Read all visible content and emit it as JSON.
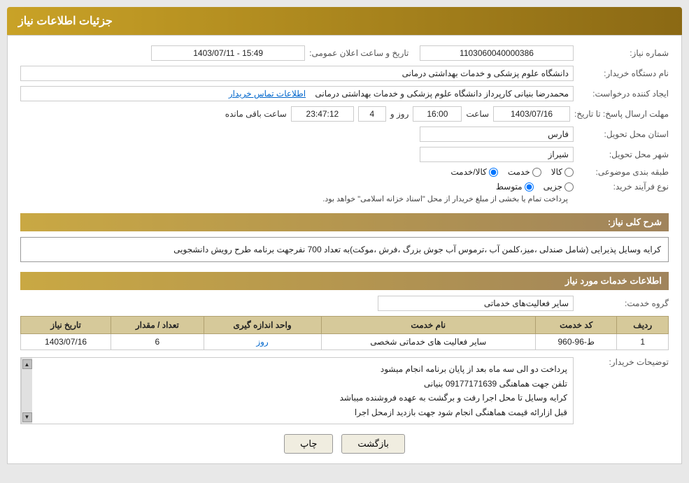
{
  "header": {
    "title": "جزئیات اطلاعات نیاز"
  },
  "fields": {
    "shomareNiaz_label": "شماره نیاز:",
    "shomareNiaz_value": "1103060040000386",
    "namDastgah_label": "نام دستگاه خریدار:",
    "namDastgah_value": "دانشگاه علوم پزشکی و خدمات بهداشتی درمانی",
    "ijadKonande_label": "ایجاد کننده درخواست:",
    "ijadKonande_value": "محمدرضا بنیانی کارپرداز دانشگاه علوم پزشکی و خدمات بهداشتی درمانی",
    "ijadKonande_link": "اطلاعات تماس خریدار",
    "mohlatErsalPasokh_label": "مهلت ارسال پاسخ: تا تاریخ:",
    "date_value": "1403/07/16",
    "saat_label": "ساعت",
    "saat_value": "16:00",
    "roz_label": "روز و",
    "roz_value": "4",
    "baghi_label": "ساعت باقی مانده",
    "baghi_value": "23:47:12",
    "ostan_label": "استان محل تحویل:",
    "ostan_value": "فارس",
    "shahr_label": "شهر محل تحویل:",
    "shahr_value": "شیراز",
    "tabaqebandi_label": "طبقه بندی موضوعی:",
    "radio_options": [
      "کالا",
      "خدمت",
      "کالا/خدمت"
    ],
    "radio_selected": "کالا/خدمت",
    "noeFarayand_label": "نوع فرآیند خرید:",
    "radio2_options": [
      "جزیی",
      "متوسط"
    ],
    "radio2_selected": "متوسط",
    "noeFarayand_notice": "پرداخت تمام یا بخشی از مبلغ خریدار از محل \"اسناد خزانه اسلامی\" خواهد بود.",
    "sharh_label": "شرح کلی نیاز:",
    "sharh_value": "کرایه وسایل پذیرایی (شامل صندلی ،میز،کلمن آب ،ترموس آب جوش بزرگ ،فرش ،موکت)به تعداد 700 نفرجهت برنامه طرح رویش دانشجویی",
    "info_section_title": "اطلاعات خدمات مورد نیاز",
    "groheKhedmat_label": "گروه خدمت:",
    "groheKhedmat_value": "سایر فعالیت‌های خدماتی",
    "table_headers": [
      "ردیف",
      "کد خدمت",
      "نام خدمت",
      "واحد اندازه گیری",
      "تعداد / مقدار",
      "تاریخ نیاز"
    ],
    "table_rows": [
      {
        "radif": "1",
        "kodKhedmat": "ط-96-960",
        "namKhedmat": "سایر فعالیت های خدماتی شخصی",
        "vahed": "روز",
        "tedad": "6",
        "tarikhNiaz": "1403/07/16"
      }
    ],
    "buyer_desc_label": "توضیحات خریدار:",
    "buyer_desc_lines": [
      "پرداخت دو الی سه ماه بعد از پایان برنامه انجام میشود",
      "تلفن جهت هماهنگی 09177171639 بنیانی",
      "کرایه وسایل تا محل اجرا رفت و برگشت به عهده فروشنده میباشد",
      "قبل ازارائه قیمت هماهنگی انجام شود جهت بازدید ازمحل اجرا"
    ]
  },
  "buttons": {
    "print_label": "چاپ",
    "back_label": "بازگشت"
  }
}
